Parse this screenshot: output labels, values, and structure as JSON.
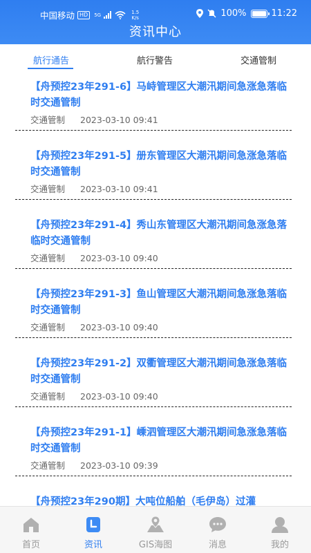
{
  "status_bar": {
    "carrier": "中国移动",
    "hd": "HD",
    "network": "5G",
    "speed_value": "1.5",
    "speed_unit": "K/s",
    "battery": "100%",
    "battery_level": 1.0,
    "time": "11:22"
  },
  "header": {
    "title": "资讯中心"
  },
  "tabs": [
    {
      "label": "航行通告",
      "active": true
    },
    {
      "label": "航行警告",
      "active": false
    },
    {
      "label": "交通管制",
      "active": false
    }
  ],
  "notices": [
    {
      "title": "【舟预控23年291-6】马峙管理区大潮汛期间急涨急落临时交通管制",
      "category": "交通管制",
      "time": "2023-03-10 09:41"
    },
    {
      "title": "【舟预控23年291-5】册东管理区大潮汛期间急涨急落临时交通管制",
      "category": "交通管制",
      "time": "2023-03-10 09:41"
    },
    {
      "title": "【舟预控23年291-4】秀山东管理区大潮汛期间急涨急落临时交通管制",
      "category": "交通管制",
      "time": "2023-03-10 09:40"
    },
    {
      "title": "【舟预控23年291-3】鱼山管理区大潮汛期间急涨急落临时交通管制",
      "category": "交通管制",
      "time": "2023-03-10 09:40"
    },
    {
      "title": "【舟预控23年291-2】双衢管理区大潮汛期间急涨急落临时交通管制",
      "category": "交通管制",
      "time": "2023-03-10 09:40"
    },
    {
      "title": "【舟预控23年291-1】嵊泗管理区大潮汛期间急涨急落临时交通管制",
      "category": "交通管制",
      "time": "2023-03-10 09:39"
    },
    {
      "title": "【舟预控23年290期】大吨位船舶（毛伊岛）过灌",
      "category": "",
      "time": ""
    }
  ],
  "tabbar": [
    {
      "label": "首页",
      "icon": "home-icon",
      "active": false
    },
    {
      "label": "资讯",
      "icon": "news-icon",
      "active": true
    },
    {
      "label": "GIS海图",
      "icon": "map-icon",
      "active": false
    },
    {
      "label": "消息",
      "icon": "message-icon",
      "active": false
    },
    {
      "label": "我的",
      "icon": "profile-icon",
      "active": false
    }
  ],
  "colors": {
    "accent": "#2f7ef0",
    "header_bg": "#3d8bf4",
    "tabbar_inactive": "#999999"
  }
}
